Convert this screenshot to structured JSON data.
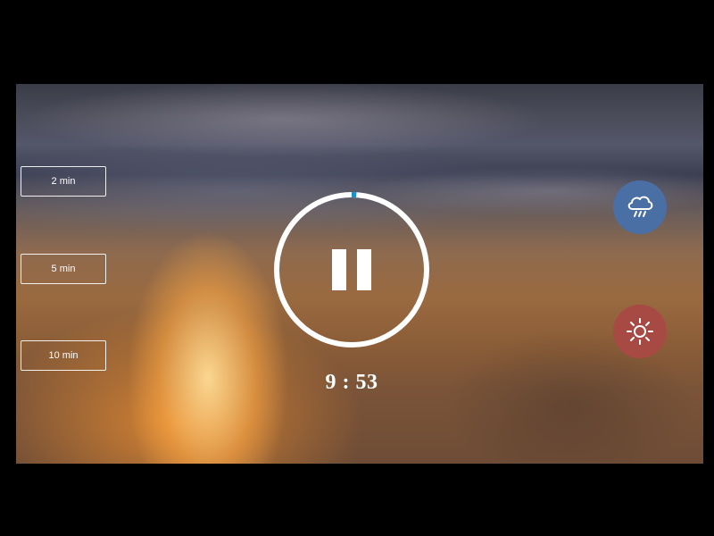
{
  "duration_options": [
    {
      "label": "2 min"
    },
    {
      "label": "5 min"
    },
    {
      "label": "10 min"
    }
  ],
  "player": {
    "state_icon": "pause-icon",
    "timer_text": "9 : 53",
    "progress_fraction": 0.01,
    "progress_color": "#1e90c8",
    "ring_color": "#ffffff"
  },
  "sound_buttons": [
    {
      "name": "rain",
      "icon": "rain-cloud-icon",
      "color": "#4a6fa5"
    },
    {
      "name": "sun",
      "icon": "sun-icon",
      "color": "#a84a44"
    }
  ]
}
